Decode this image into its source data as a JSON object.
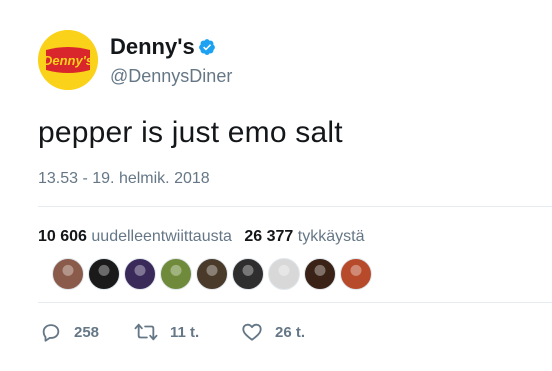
{
  "author": {
    "display_name": "Denny's",
    "handle": "@DennysDiner",
    "logo_text": "Denny's",
    "brand_colors": {
      "red": "#d9262c",
      "yellow": "#fbd21a"
    },
    "verified": true
  },
  "tweet": {
    "text": "pepper is just emo salt",
    "timestamp": "13.53 - 19. helmik. 2018"
  },
  "stats": {
    "retweets_count": "10 606",
    "retweets_label": "uudelleentwiittausta",
    "likes_count": "26 377",
    "likes_label": "tykkäystä"
  },
  "likers": [
    {
      "icon": "user-avatar",
      "color": "#8a5a4a"
    },
    {
      "icon": "user-avatar",
      "color": "#1a1a1a"
    },
    {
      "icon": "user-avatar",
      "color": "#3a2a5a"
    },
    {
      "icon": "user-avatar",
      "color": "#6e8a3a"
    },
    {
      "icon": "user-avatar",
      "color": "#4a3a2a"
    },
    {
      "icon": "user-avatar",
      "color": "#2e2e2e"
    },
    {
      "icon": "user-avatar",
      "color": "#d8d8d8"
    },
    {
      "icon": "user-avatar",
      "color": "#3a2216"
    },
    {
      "icon": "user-avatar",
      "color": "#b64a2a"
    }
  ],
  "actions": {
    "reply_count": "258",
    "retweet_count": "11 t.",
    "like_count": "26 t."
  },
  "colors": {
    "text_primary": "#14171a",
    "text_secondary": "#657786",
    "verified_blue": "#1da1f2",
    "divider": "#e6ecf0"
  }
}
